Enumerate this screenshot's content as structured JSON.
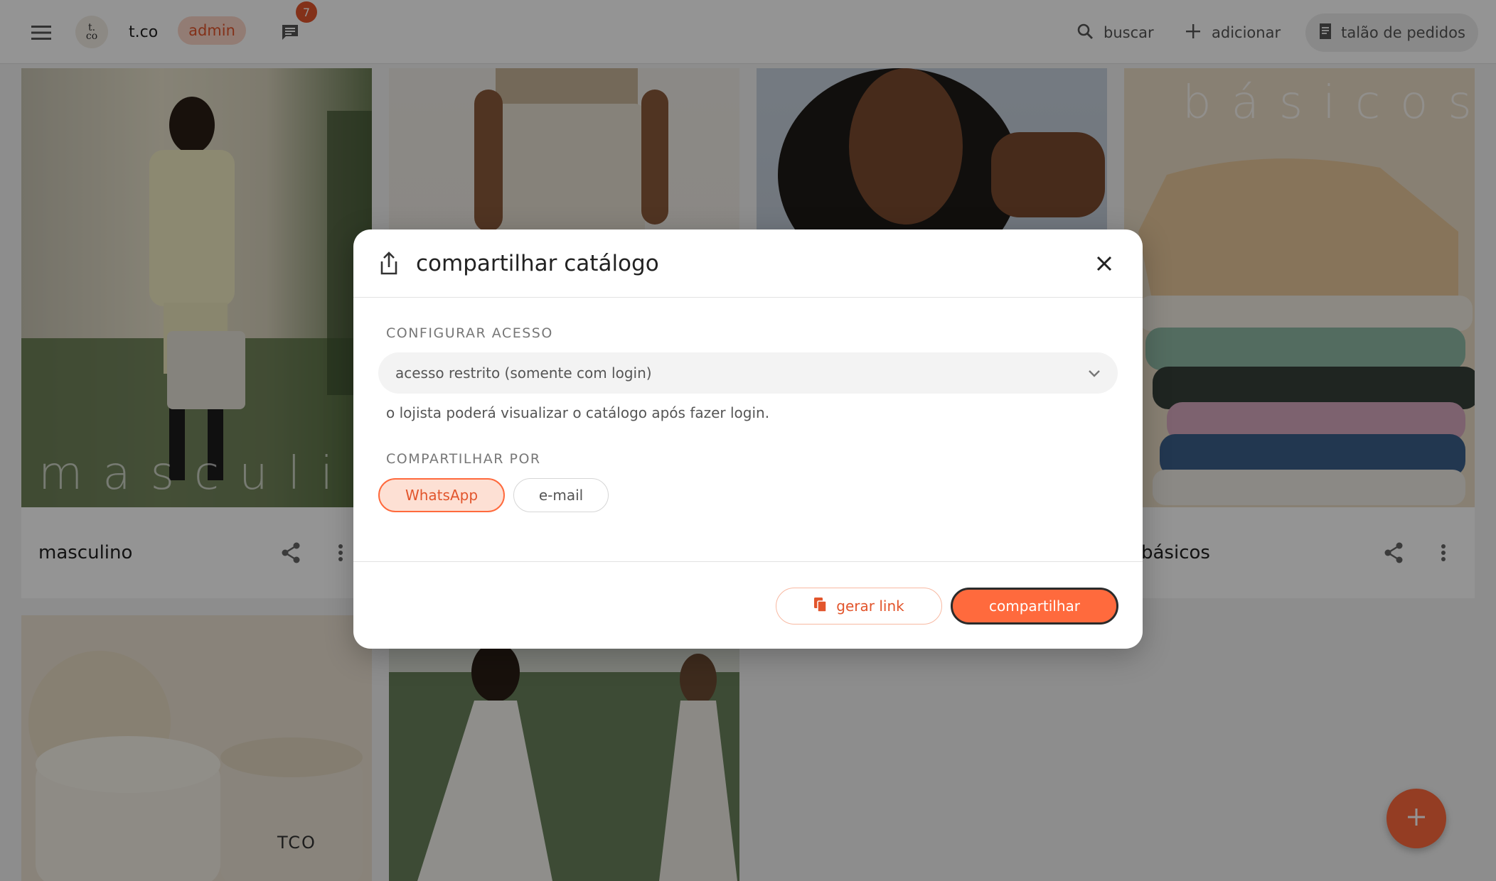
{
  "topbar": {
    "brand": "t.co",
    "logo_text_top": "t.",
    "logo_text_bottom": "co",
    "role_badge": "admin",
    "chat_count": "7",
    "search_label": "buscar",
    "add_label": "adicionar",
    "orders_label": "talão de pedidos",
    "icons": [
      "menu-icon",
      "chat-icon",
      "search-icon",
      "plus-icon",
      "notepad-icon"
    ]
  },
  "cards": [
    {
      "title": "masculino",
      "overlay": "masculino"
    },
    {
      "title": "",
      "overlay": ""
    },
    {
      "title": "",
      "overlay": ""
    },
    {
      "title": "básicos",
      "overlay": "básicos"
    },
    {
      "title": "",
      "overlay": "",
      "product_text": "TCO"
    },
    {
      "title": "",
      "overlay": ""
    }
  ],
  "modal": {
    "title": "compartilhar catálogo",
    "access_section_label": "CONFIGURAR ACESSO",
    "access_value": "acesso restrito (somente com login)",
    "access_helper": "o lojista poderá visualizar o catálogo após fazer login.",
    "share_section_label": "COMPARTILHAR POR",
    "share_options": [
      {
        "label": "WhatsApp",
        "selected": true
      },
      {
        "label": "e-mail",
        "selected": false
      }
    ],
    "generate_link_label": "gerar link",
    "share_button_label": "compartilhar"
  },
  "colors": {
    "accent": "#ff6a3d",
    "accent_text": "#e2552c",
    "accent_soft": "#fde0d4"
  }
}
